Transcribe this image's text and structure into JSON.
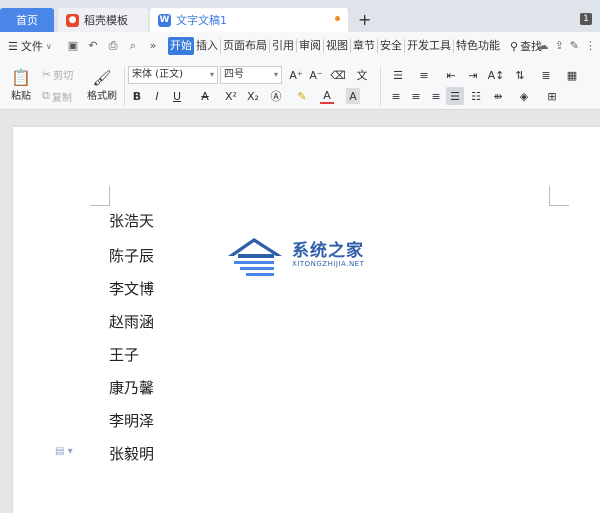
{
  "tabs": {
    "home": "首页",
    "daoke": "稻壳模板",
    "doc": "文字文稿1",
    "badge": "1",
    "new_tab": "+"
  },
  "menu": {
    "file": "文件",
    "items": [
      "开始",
      "插入",
      "页面布局",
      "引用",
      "审阅",
      "视图",
      "章节",
      "安全",
      "开发工具",
      "特色功能"
    ],
    "active_index": 0,
    "search": "查找"
  },
  "ribbon": {
    "paste": "粘贴",
    "cut": "剪切",
    "copy": "复制",
    "format_painter": "格式刷",
    "font_family": "宋体 (正文)",
    "font_size": "四号",
    "bold": "B",
    "italic": "I",
    "underline": "U",
    "strike": "A",
    "superscript": "X²",
    "subscript": "X₂",
    "font_color": "A",
    "char_shading": "A",
    "grow": "A⁺",
    "shrink": "A⁻"
  },
  "document": {
    "names": [
      "张浩天",
      "陈子辰",
      "李文博",
      "赵雨涵",
      "王子",
      "康乃馨",
      "李明泽",
      "张毅明"
    ]
  },
  "watermark": {
    "title": "系统之家",
    "subtitle": "XITONGZHIJIA.NET"
  },
  "colors": {
    "accent": "#3b7be0",
    "home_tab": "#4a86e8",
    "watermark": "#2f5fa8"
  }
}
